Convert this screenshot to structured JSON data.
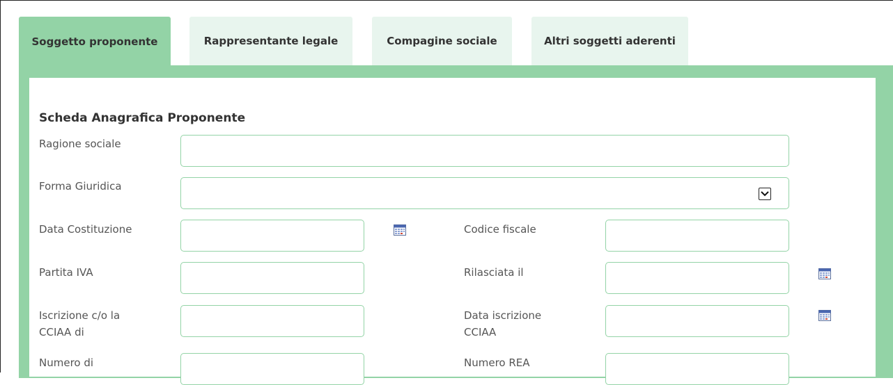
{
  "tabs": [
    {
      "label": "Soggetto proponente",
      "active": true
    },
    {
      "label": "Rappresentante legale",
      "active": false
    },
    {
      "label": "Compagine sociale",
      "active": false
    },
    {
      "label": "Altri soggetti aderenti",
      "active": false
    }
  ],
  "section_title": "Scheda Anagrafica Proponente",
  "fields": {
    "ragione_sociale": {
      "label": "Ragione sociale",
      "value": ""
    },
    "forma_giuridica": {
      "label": "Forma Giuridica",
      "value": ""
    },
    "data_costituzione": {
      "label": "Data Costituzione",
      "value": ""
    },
    "codice_fiscale": {
      "label": "Codice fiscale",
      "value": ""
    },
    "partita_iva": {
      "label": "Partita IVA",
      "value": ""
    },
    "rilasciata_il": {
      "label": "Rilasciata il",
      "value": ""
    },
    "iscrizione_line1": {
      "label": "Iscrizione c/o la"
    },
    "iscrizione_line2": {
      "label": "CCIAA di"
    },
    "data_iscrizione_line1": {
      "label": "Data iscrizione"
    },
    "data_iscrizione_line2": {
      "label": "CCIAA"
    },
    "numero_di": {
      "label": "Numero di",
      "value": ""
    },
    "numero_rea": {
      "label": "Numero REA",
      "value": ""
    }
  },
  "icons": {
    "calendar": "calendar-icon",
    "dropdown": "chevron-down-icon"
  },
  "colors": {
    "accent": "#93d3a6",
    "tab_inactive": "#e8f5ee"
  }
}
